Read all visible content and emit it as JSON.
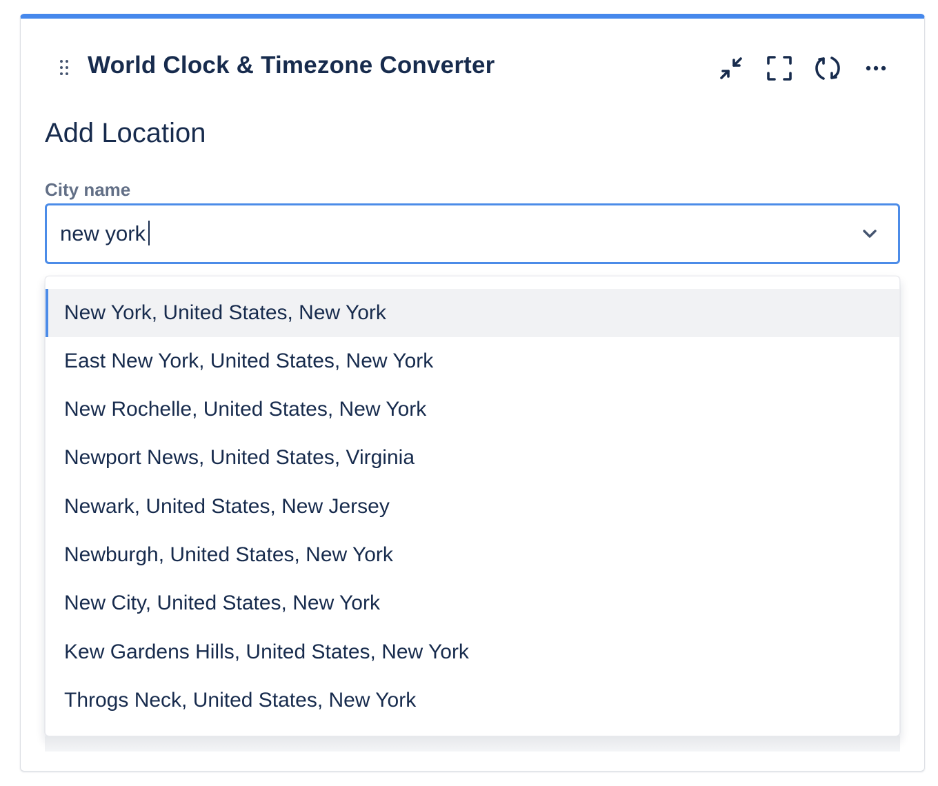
{
  "header": {
    "title": "World Clock & Timezone Converter",
    "actions": [
      {
        "name": "minimize",
        "icon": "minimize-arrows-icon"
      },
      {
        "name": "fullscreen",
        "icon": "fullscreen-icon"
      },
      {
        "name": "refresh",
        "icon": "refresh-icon"
      },
      {
        "name": "more",
        "icon": "more-horizontal-icon"
      }
    ]
  },
  "form": {
    "section_title": "Add Location",
    "city_label": "City name",
    "city_value": "new york"
  },
  "dropdown": {
    "options": [
      {
        "label": "New York, United States, New York",
        "highlighted": true
      },
      {
        "label": "East New York, United States, New York",
        "highlighted": false
      },
      {
        "label": "New Rochelle, United States, New York",
        "highlighted": false
      },
      {
        "label": "Newport News, United States, Virginia",
        "highlighted": false
      },
      {
        "label": "Newark, United States, New Jersey",
        "highlighted": false
      },
      {
        "label": "Newburgh, United States, New York",
        "highlighted": false
      },
      {
        "label": "New City, United States, New York",
        "highlighted": false
      },
      {
        "label": "Kew Gardens Hills, United States, New York",
        "highlighted": false
      },
      {
        "label": "Throgs Neck, United States, New York",
        "highlighted": false
      }
    ]
  },
  "colors": {
    "accent": "#4688ec",
    "text": "#172b4d",
    "label": "#626f86",
    "highlight_bg": "#f1f2f4"
  }
}
